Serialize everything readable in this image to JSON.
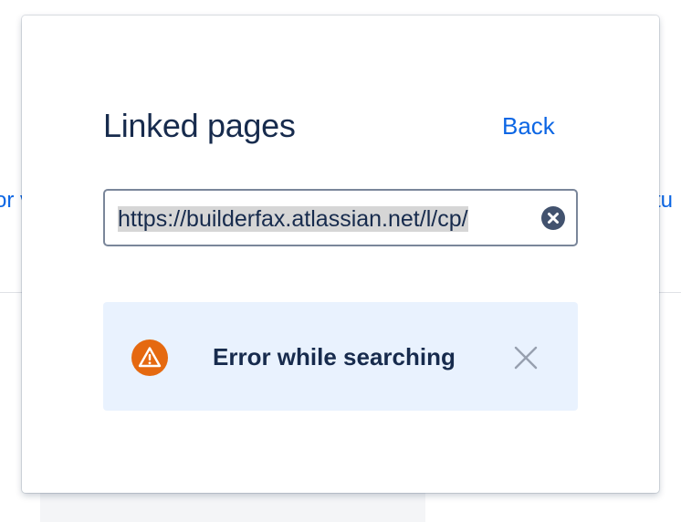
{
  "background": {
    "left_fragment": "or v",
    "right_fragment": "tu"
  },
  "popup": {
    "title": "Linked pages",
    "back_label": "Back",
    "search": {
      "value": "https://builderfax.atlassian.net/l/cp/"
    },
    "error_flag": {
      "message": "Error while searching",
      "icon": "warning-icon",
      "accent_color": "#e56910",
      "background_color": "#e9f2fe"
    }
  },
  "colors": {
    "link": "#0c66e4",
    "text": "#172b4d"
  }
}
